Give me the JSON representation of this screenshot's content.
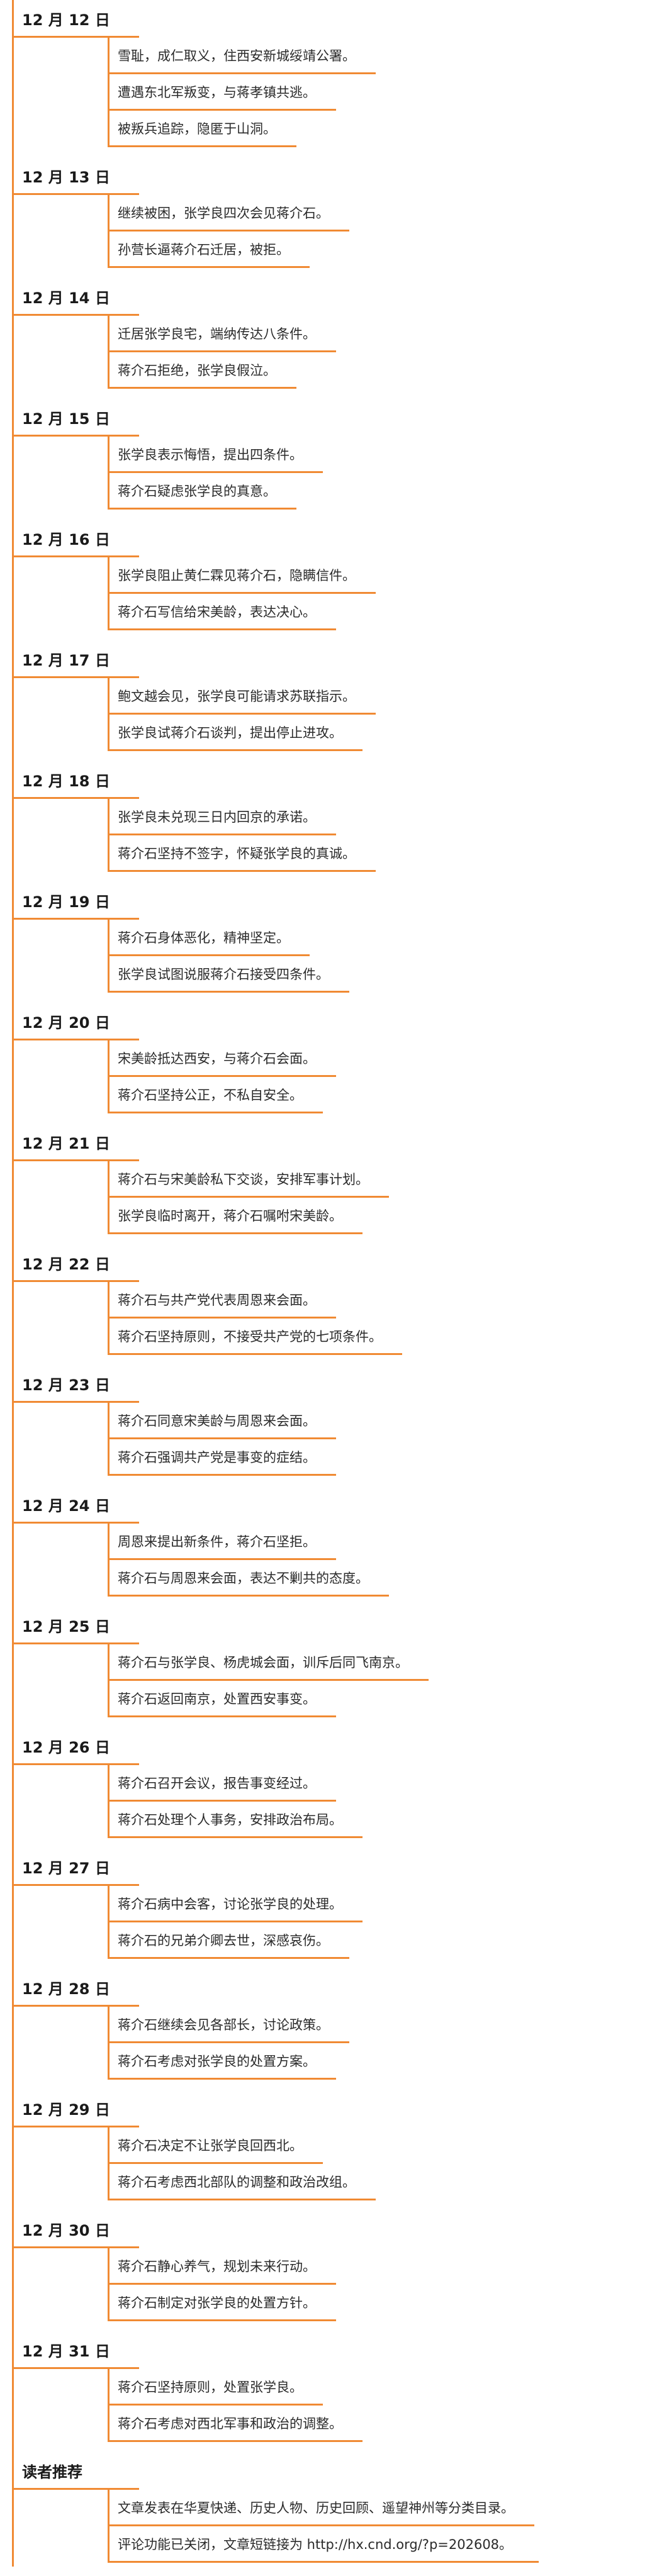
{
  "accent_color": "#f08a33",
  "sections": [
    {
      "date": "12 月 12 日",
      "items": [
        "雪耻，成仁取义，住西安新城绥靖公署。",
        "遭遇东北军叛变，与蒋孝镇共逃。",
        "被叛兵追踪，隐匿于山洞。"
      ]
    },
    {
      "date": "12 月 13 日",
      "items": [
        "继续被困，张学良四次会见蒋介石。",
        "孙营长逼蒋介石迁居，被拒。"
      ]
    },
    {
      "date": "12 月 14 日",
      "items": [
        "迁居张学良宅，端纳传达八条件。",
        "蒋介石拒绝，张学良假泣。"
      ]
    },
    {
      "date": "12 月 15 日",
      "items": [
        "张学良表示悔悟，提出四条件。",
        "蒋介石疑虑张学良的真意。"
      ]
    },
    {
      "date": "12 月 16 日",
      "items": [
        "张学良阻止黄仁霖见蒋介石，隐瞒信件。",
        "蒋介石写信给宋美龄，表达决心。"
      ]
    },
    {
      "date": "12 月 17 日",
      "items": [
        "鲍文越会见，张学良可能请求苏联指示。",
        "张学良试蒋介石谈判，提出停止进攻。"
      ]
    },
    {
      "date": "12 月 18 日",
      "items": [
        "张学良未兑现三日内回京的承诺。",
        "蒋介石坚持不签字，怀疑张学良的真诚。"
      ]
    },
    {
      "date": "12 月 19 日",
      "items": [
        "蒋介石身体恶化，精神坚定。",
        "张学良试图说服蒋介石接受四条件。"
      ]
    },
    {
      "date": "12 月 20 日",
      "items": [
        "宋美龄抵达西安，与蒋介石会面。",
        "蒋介石坚持公正，不私自安全。"
      ]
    },
    {
      "date": "12 月 21 日",
      "items": [
        "蒋介石与宋美龄私下交谈，安排军事计划。",
        "张学良临时离开，蒋介石嘱咐宋美龄。"
      ]
    },
    {
      "date": "12 月 22 日",
      "items": [
        "蒋介石与共产党代表周恩来会面。",
        "蒋介石坚持原则，不接受共产党的七项条件。"
      ]
    },
    {
      "date": "12 月 23 日",
      "items": [
        "蒋介石同意宋美龄与周恩来会面。",
        "蒋介石强调共产党是事变的症结。"
      ]
    },
    {
      "date": "12 月 24 日",
      "items": [
        "周恩来提出新条件，蒋介石坚拒。",
        "蒋介石与周恩来会面，表达不剿共的态度。"
      ]
    },
    {
      "date": "12 月 25 日",
      "items": [
        "蒋介石与张学良、杨虎城会面，训斥后同飞南京。",
        "蒋介石返回南京，处置西安事变。"
      ]
    },
    {
      "date": "12 月 26 日",
      "items": [
        "蒋介石召开会议，报告事变经过。",
        "蒋介石处理个人事务，安排政治布局。"
      ]
    },
    {
      "date": "12 月 27 日",
      "items": [
        "蒋介石病中会客，讨论张学良的处理。",
        "蒋介石的兄弟介卿去世，深感哀伤。"
      ]
    },
    {
      "date": "12 月 28 日",
      "items": [
        "蒋介石继续会见各部长，讨论政策。",
        "蒋介石考虑对张学良的处置方案。"
      ]
    },
    {
      "date": "12 月 29 日",
      "items": [
        "蒋介石决定不让张学良回西北。",
        "蒋介石考虑西北部队的调整和政治改组。"
      ]
    },
    {
      "date": "12 月 30 日",
      "items": [
        "蒋介石静心养气，规划未来行动。",
        "蒋介石制定对张学良的处置方针。"
      ]
    },
    {
      "date": "12 月 31 日",
      "items": [
        "蒋介石坚持原则，处置张学良。",
        "蒋介石考虑对西北军事和政治的调整。"
      ]
    },
    {
      "date": "读者推荐",
      "items": [
        "文章发表在华夏快递、历史人物、历史回顾、遥望神州等分类目录。",
        "评论功能已关闭，文章短链接为 http://hx.cnd.org/?p=202608。"
      ]
    }
  ]
}
